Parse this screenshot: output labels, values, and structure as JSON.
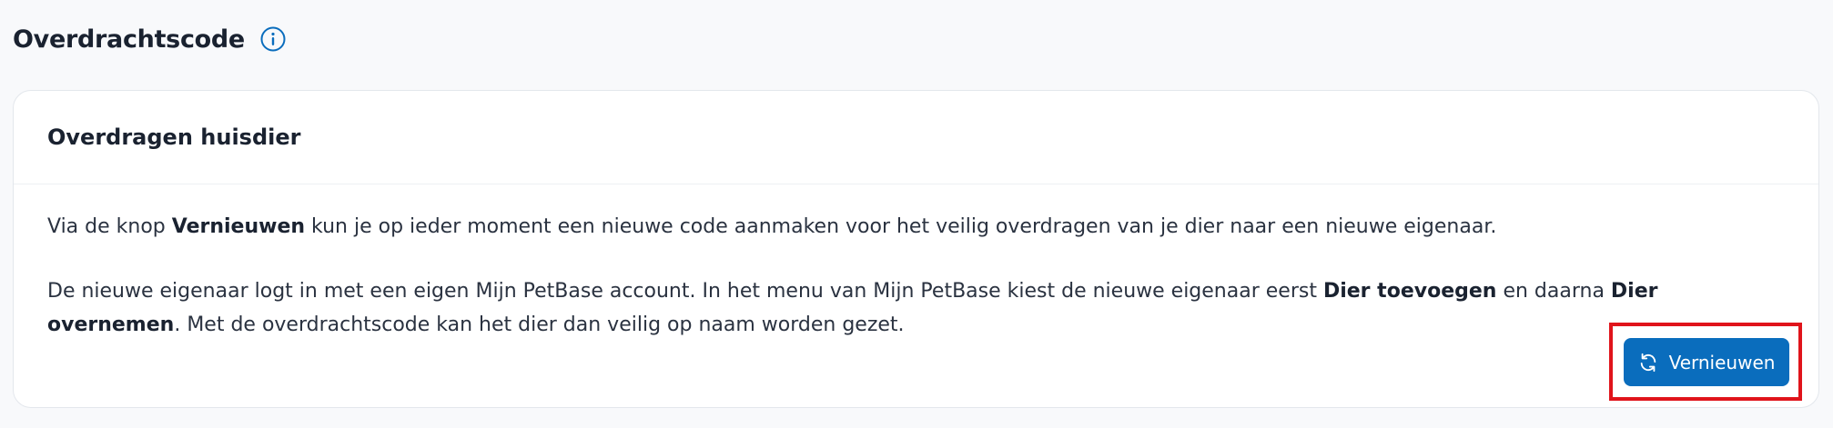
{
  "section": {
    "title": "Overdrachtscode",
    "info_icon": "info-icon"
  },
  "card": {
    "title": "Overdragen huisdier",
    "paragraph1": {
      "before": "Via de knop ",
      "bold": "Vernieuwen",
      "after": " kun je op ieder moment een nieuwe code aanmaken voor het veilig overdragen van je dier naar een nieuwe eigenaar."
    },
    "paragraph2": {
      "part1": "De nieuwe eigenaar logt in met een eigen Mijn PetBase account. In het menu van Mijn PetBase kiest de nieuwe eigenaar eerst ",
      "bold1": "Dier toevoegen",
      "part2": " en daarna ",
      "bold2": "Dier overnemen",
      "part3": ". Met de overdrachtscode kan het dier dan veilig op naam worden gezet."
    },
    "button": {
      "label": "Vernieuwen",
      "icon": "refresh-icon"
    }
  },
  "colors": {
    "accent": "#0a6dbd",
    "highlight": "#e0141b",
    "background": "#f8f9fb"
  }
}
